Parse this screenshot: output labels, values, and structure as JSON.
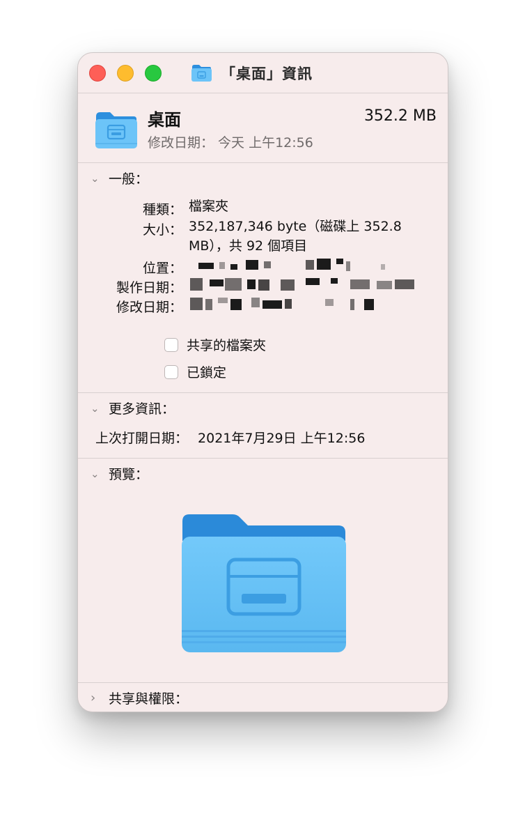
{
  "window": {
    "title": "「桌面」資訊"
  },
  "header": {
    "name": "桌面",
    "size": "352.2 MB",
    "modified": "修改日期： 今天 上午12:56"
  },
  "general": {
    "section_title": "一般：",
    "kind_label": "種類：",
    "kind_value": "檔案夾",
    "size_label": "大小：",
    "size_value_line1": "352,187,346 byte（磁碟上 352.8",
    "size_value_line2": "MB），共 92 個項目",
    "where_label": "位置：",
    "created_label": "製作日期：",
    "modified_label": "修改日期：",
    "shared_folder_label": "共享的檔案夾",
    "locked_label": "已鎖定"
  },
  "more_info": {
    "section_title": "更多資訊：",
    "last_opened_label": "上次打開日期：",
    "last_opened_value": "2021年7月29日 上午12:56"
  },
  "preview": {
    "section_title": "預覽："
  },
  "sharing": {
    "section_title": "共享與權限："
  },
  "icons": {
    "folder": "folder-icon",
    "chevron_down": "chevron-down-icon",
    "chevron_right": "chevron-right-icon"
  },
  "colors": {
    "folder_light": "#6cc4f8",
    "folder_dark": "#2d8fde",
    "window_bg": "#f7ecec",
    "close": "#fe5f57",
    "minimize": "#febc2e",
    "zoom": "#28c840"
  }
}
